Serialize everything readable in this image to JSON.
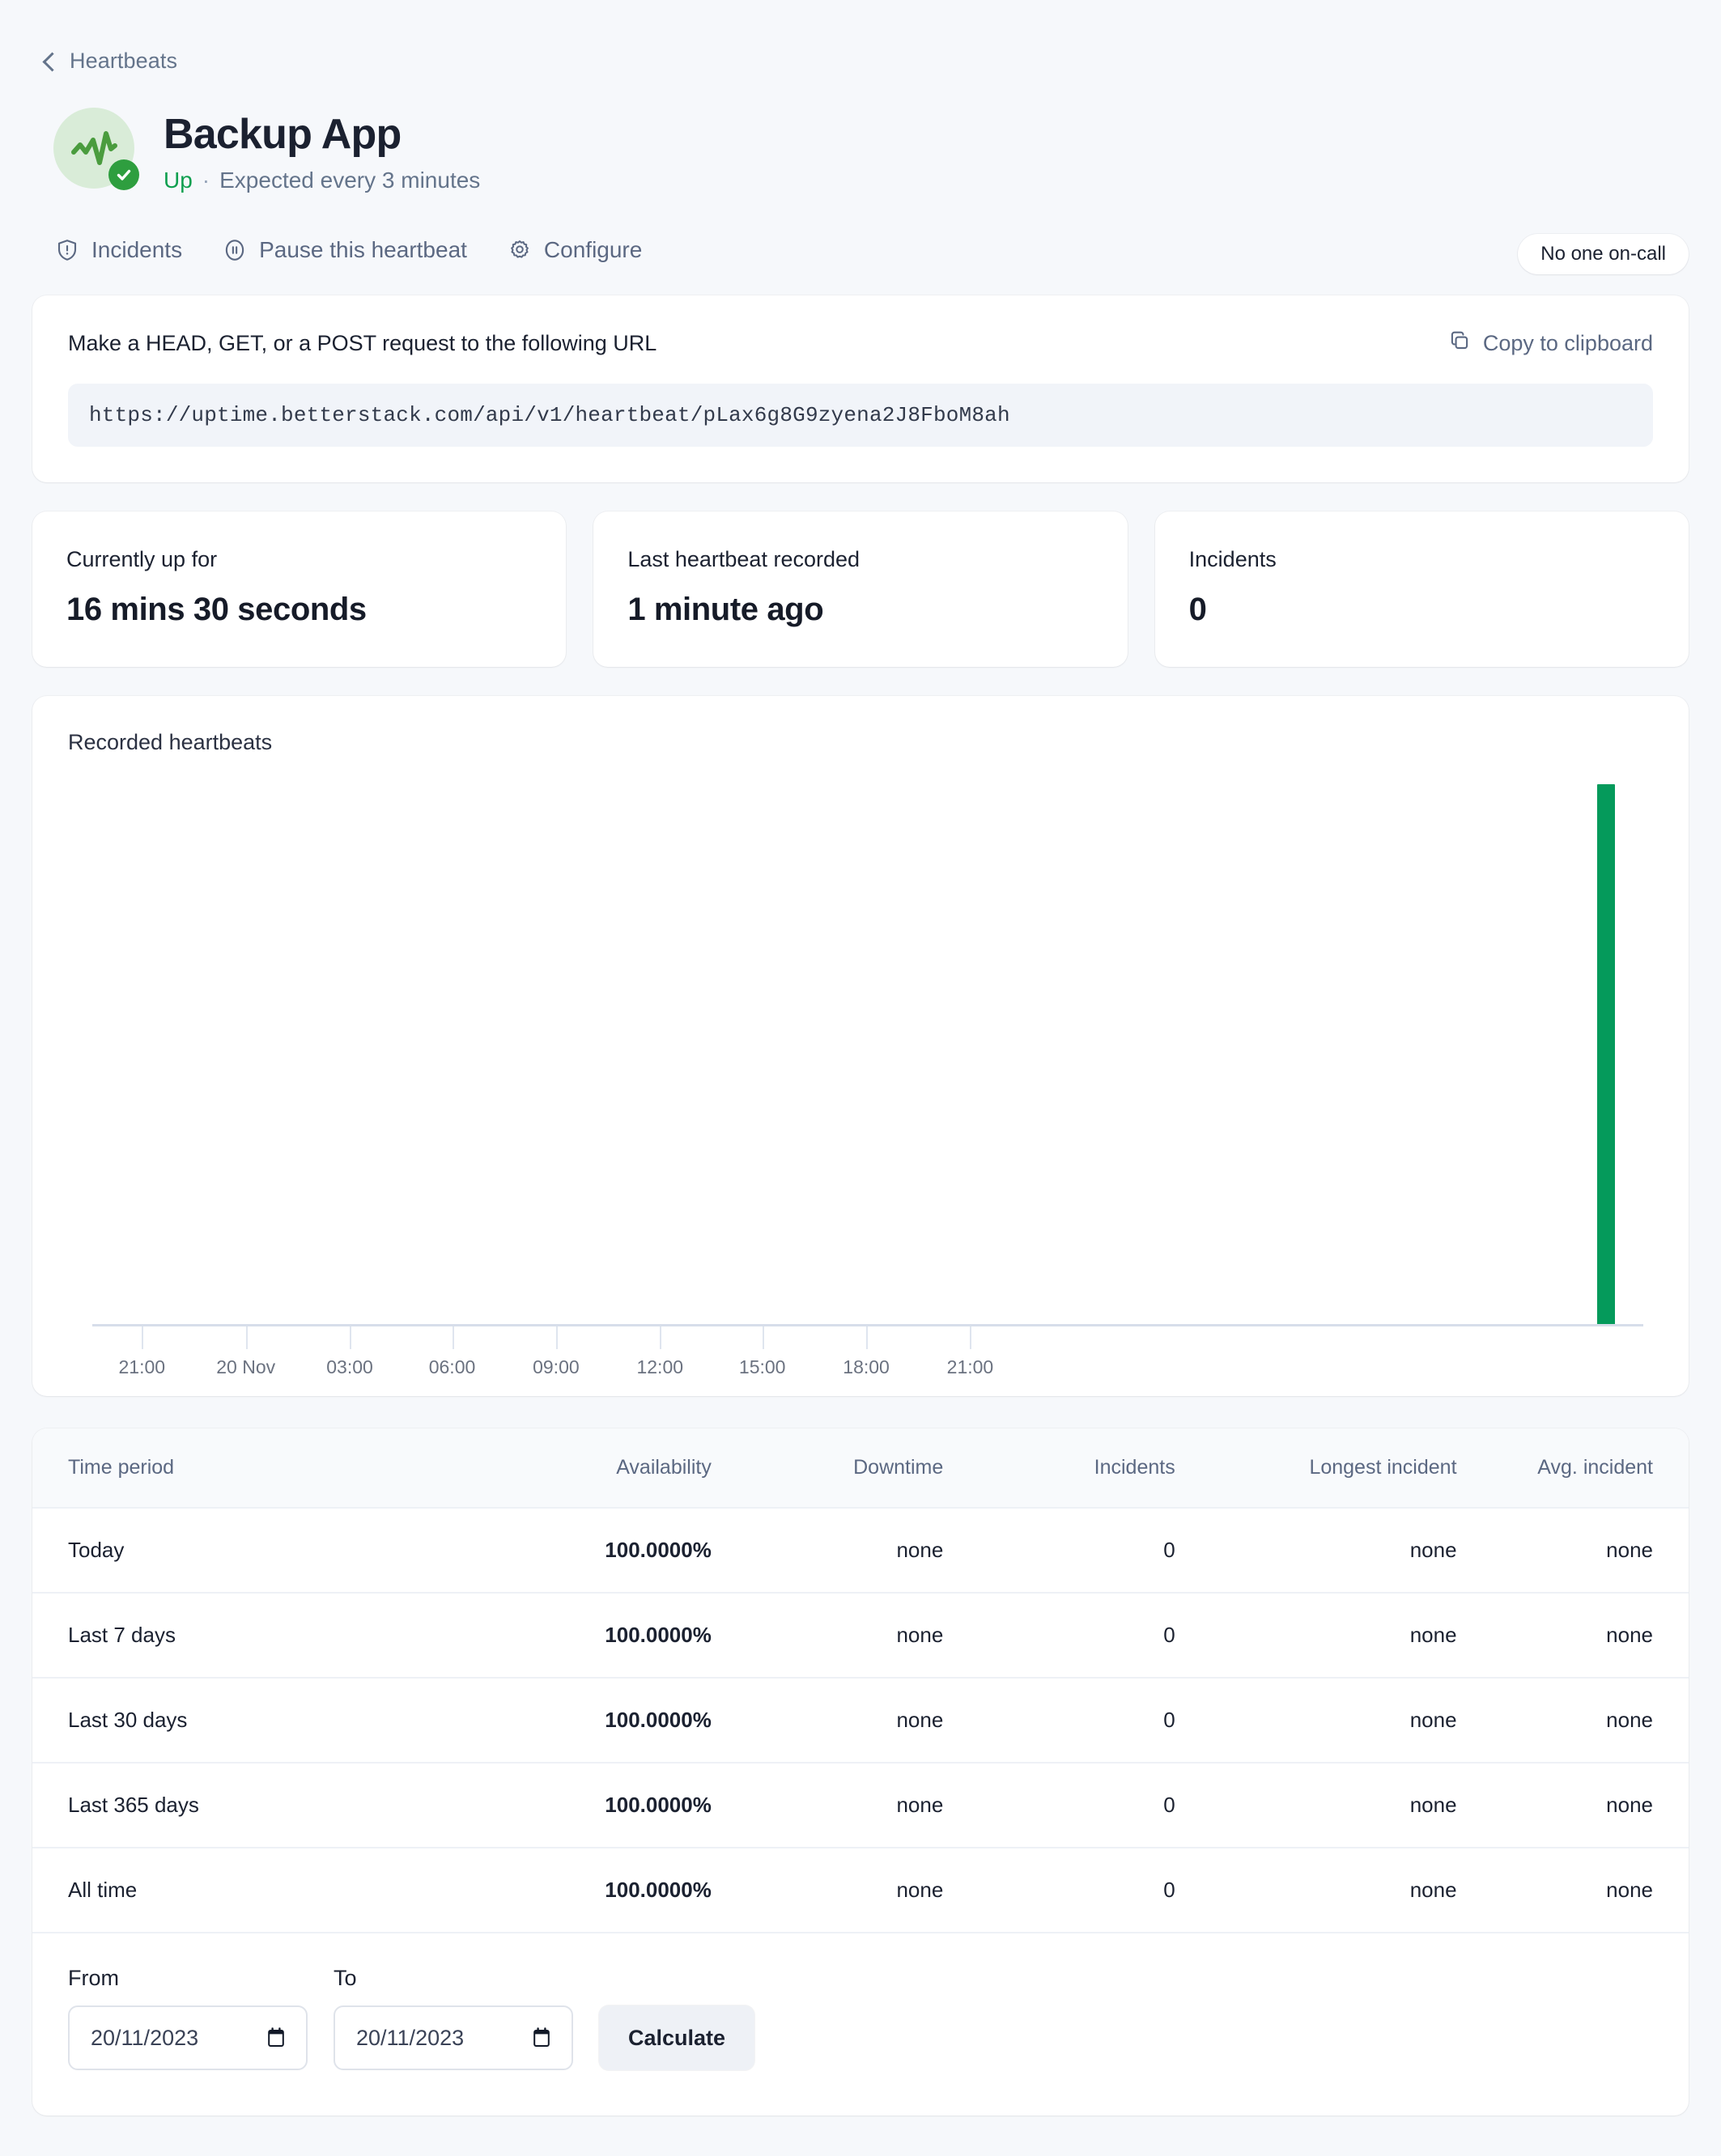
{
  "breadcrumb": {
    "label": "Heartbeats",
    "icon": "chevron-left-icon"
  },
  "header": {
    "title": "Backup App",
    "status": "Up",
    "separator": "·",
    "expectation": "Expected every 3 minutes",
    "status_color": "#0e9f4f",
    "avatar_icon": "heartbeat-activity-icon",
    "badge_icon": "check-circle-icon"
  },
  "actions": [
    {
      "label": "Incidents",
      "icon": "shield-alert-icon"
    },
    {
      "label": "Pause this heartbeat",
      "icon": "pause-circle-icon"
    },
    {
      "label": "Configure",
      "icon": "gear-icon"
    }
  ],
  "oncall": {
    "label": "No one on-call"
  },
  "url_card": {
    "instruction": "Make a HEAD, GET, or a POST request to the following URL",
    "copy_label": "Copy to clipboard",
    "copy_icon": "copy-icon",
    "url": "https://uptime.betterstack.com/api/v1/heartbeat/pLax6g8G9zyena2J8FboM8ah"
  },
  "stats": [
    {
      "label": "Currently up for",
      "value": "16 mins 30 seconds"
    },
    {
      "label": "Last heartbeat recorded",
      "value": "1 minute ago"
    },
    {
      "label": "Incidents",
      "value": "0"
    }
  ],
  "chart_data": {
    "type": "bar",
    "title": "Recorded heartbeats",
    "xlabel": "",
    "ylabel": "",
    "grid": false,
    "legend": "none",
    "bar_color": "#059a5b",
    "axis_color": "#d7deea",
    "categories": [
      "21:00",
      "20 Nov",
      "03:00",
      "06:00",
      "09:00",
      "12:00",
      "15:00",
      "18:00",
      "21:00"
    ],
    "tick_positions_pct": [
      3.2,
      9.9,
      16.6,
      23.2,
      29.9,
      36.6,
      43.2,
      49.9,
      56.6
    ],
    "x": [
      97.0
    ],
    "values": [
      100
    ],
    "ylim": [
      0,
      100
    ],
    "series": [
      {
        "name": "heartbeats",
        "values": [
          100
        ]
      }
    ]
  },
  "table": {
    "columns": [
      "Time period",
      "Availability",
      "Downtime",
      "Incidents",
      "Longest incident",
      "Avg. incident"
    ],
    "rows": [
      {
        "period": "Today",
        "availability": "100.0000%",
        "downtime": "none",
        "incidents": "0",
        "longest": "none",
        "avg": "none"
      },
      {
        "period": "Last 7 days",
        "availability": "100.0000%",
        "downtime": "none",
        "incidents": "0",
        "longest": "none",
        "avg": "none"
      },
      {
        "period": "Last 30 days",
        "availability": "100.0000%",
        "downtime": "none",
        "incidents": "0",
        "longest": "none",
        "avg": "none"
      },
      {
        "period": "Last 365 days",
        "availability": "100.0000%",
        "downtime": "none",
        "incidents": "0",
        "longest": "none",
        "avg": "none"
      },
      {
        "period": "All time",
        "availability": "100.0000%",
        "downtime": "none",
        "incidents": "0",
        "longest": "none",
        "avg": "none"
      }
    ]
  },
  "form": {
    "from_label": "From",
    "to_label": "To",
    "from_value": "20/11/2023",
    "to_value": "20/11/2023",
    "calculate_label": "Calculate",
    "calendar_icon": "calendar-icon"
  }
}
